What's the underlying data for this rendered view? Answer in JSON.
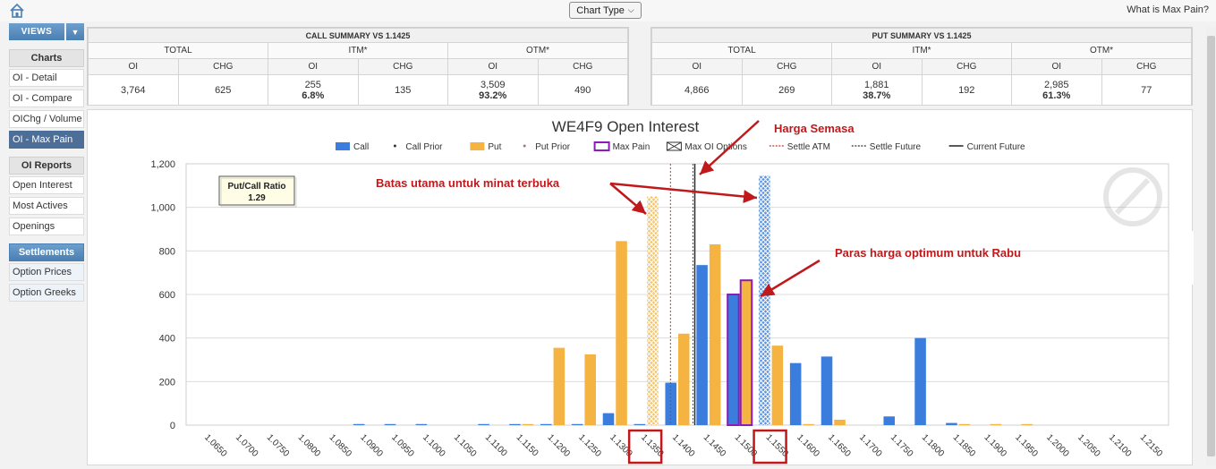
{
  "topbar": {
    "chart_type_label": "Chart Type",
    "max_pain_link": "What is Max Pain?"
  },
  "sidebar": {
    "views_label": "VIEWS",
    "charts_header": "Charts",
    "chart_items": [
      "OI - Detail",
      "OI - Compare",
      "OIChg / Volume",
      "OI - Max Pain"
    ],
    "active_index": 3,
    "reports_header": "OI Reports",
    "report_items": [
      "Open Interest",
      "Most Actives",
      "Openings"
    ],
    "settlements_header": "Settlements",
    "settlement_items": [
      "Option Prices",
      "Option Greeks"
    ]
  },
  "call_summary": {
    "title": "CALL SUMMARY VS 1.1425",
    "groups": [
      "TOTAL",
      "ITM*",
      "OTM*"
    ],
    "sub_headers": [
      "OI",
      "CHG",
      "OI",
      "CHG",
      "OI",
      "CHG"
    ],
    "values": {
      "total_oi": "3,764",
      "total_chg": "625",
      "itm_oi": "255",
      "itm_pct": "6.8%",
      "itm_chg": "135",
      "otm_oi": "3,509",
      "otm_pct": "93.2%",
      "otm_chg": "490"
    }
  },
  "put_summary": {
    "title": "PUT SUMMARY VS 1.1425",
    "groups": [
      "TOTAL",
      "ITM*",
      "OTM*"
    ],
    "sub_headers": [
      "OI",
      "CHG",
      "OI",
      "CHG",
      "OI",
      "CHG"
    ],
    "values": {
      "total_oi": "4,866",
      "total_chg": "269",
      "itm_oi": "1,881",
      "itm_pct": "38.7%",
      "itm_chg": "192",
      "otm_oi": "2,985",
      "otm_pct": "61.3%",
      "otm_chg": "77"
    }
  },
  "ratio_box": {
    "label": "Put/Call Ratio",
    "value": "1.29"
  },
  "annotations": {
    "current_price": "Harga Semasa",
    "main_barrier": "Batas utama untuk minat terbuka",
    "optimum_level": "Paras harga optimum untuk Rabu"
  },
  "chart_data": {
    "type": "bar",
    "title": "WE4F9 Open Interest",
    "xlabel": "",
    "ylabel": "",
    "ylim": [
      0,
      1200
    ],
    "yticks": [
      0,
      200,
      400,
      600,
      800,
      1000,
      1200
    ],
    "ytick_labels": [
      "0",
      "200",
      "400",
      "600",
      "800",
      "1,000",
      "1,200"
    ],
    "grid": true,
    "legend_position": "top",
    "legend": [
      "Call",
      "Call Prior",
      "Put",
      "Put Prior",
      "Max Pain",
      "Max OI Options",
      "Settle ATM",
      "Settle Future",
      "Current Future"
    ],
    "categories": [
      "1.0650",
      "1.0700",
      "1.0750",
      "1.0800",
      "1.0850",
      "1.0900",
      "1.0950",
      "1.1000",
      "1.1050",
      "1.1100",
      "1.1150",
      "1.1200",
      "1.1250",
      "1.1300",
      "1.1350",
      "1.1400",
      "1.1450",
      "1.1500",
      "1.1550",
      "1.1600",
      "1.1650",
      "1.1700",
      "1.1750",
      "1.1800",
      "1.1850",
      "1.1900",
      "1.1950",
      "1.2000",
      "1.2050",
      "1.2100",
      "1.2150"
    ],
    "series": [
      {
        "name": "Call",
        "color": "#3b7ddd",
        "values": [
          0,
          0,
          0,
          0,
          0,
          5,
          5,
          5,
          0,
          5,
          5,
          5,
          5,
          55,
          5,
          195,
          735,
          600,
          1145,
          285,
          315,
          0,
          40,
          400,
          10,
          0,
          0,
          0,
          0,
          0,
          0
        ]
      },
      {
        "name": "Put",
        "color": "#f5b342",
        "values": [
          0,
          0,
          0,
          0,
          0,
          0,
          0,
          0,
          0,
          0,
          5,
          355,
          325,
          845,
          1050,
          420,
          830,
          665,
          365,
          5,
          25,
          0,
          0,
          0,
          5,
          5,
          5,
          0,
          0,
          0,
          0
        ]
      }
    ],
    "max_oi_options": {
      "put_strike": "1.1350",
      "call_strike": "1.1550"
    },
    "max_pain_strike": "1.1500",
    "settle_atm": 1.1389,
    "settle_future": 1.1425,
    "current_future": 1.1428,
    "highlighted_strikes": [
      "1.1350",
      "1.1550"
    ],
    "colors": {
      "call": "#3b7ddd",
      "put": "#f5b342",
      "max_pain": "#8a1db5",
      "settle_atm": "#c0392b",
      "annotation": "#c0191c"
    }
  }
}
